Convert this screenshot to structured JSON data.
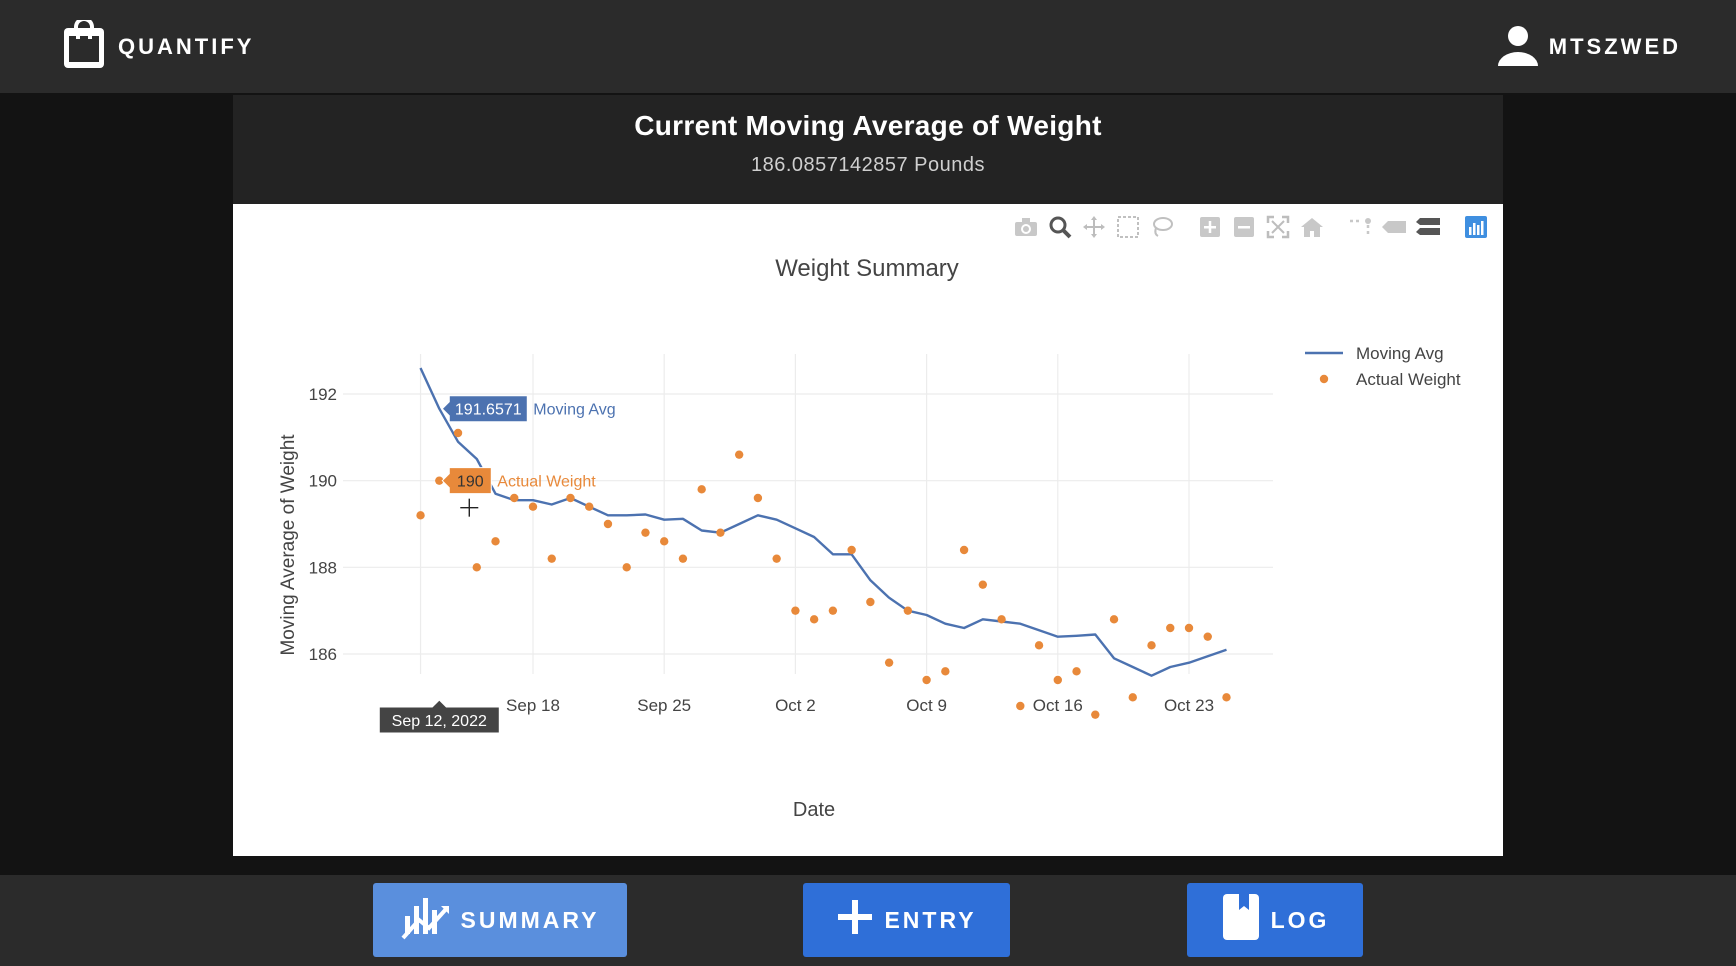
{
  "app": {
    "name": "QUANTIFY",
    "user": "MTSZWED"
  },
  "header": {
    "title": "Current Moving Average of Weight",
    "value_text": "186.0857142857 Pounds"
  },
  "modebar": {
    "icons": [
      "camera-icon",
      "zoom-icon",
      "pan-icon",
      "box-select-icon",
      "lasso-icon",
      "zoom-in-icon",
      "zoom-out-icon",
      "autoscale-icon",
      "reset-axes-icon",
      "spike-lines-icon",
      "hover-closest-icon",
      "hover-compare-icon",
      "plotly-logo-icon"
    ]
  },
  "nav": {
    "summary": "SUMMARY",
    "entry": "ENTRY",
    "log": "LOG"
  },
  "hover": {
    "moving_avg_value": "191.6571",
    "moving_avg_name": "Moving Avg",
    "actual_value": "190",
    "actual_name": "Actual Weight",
    "date": "Sep 12, 2022"
  },
  "colors": {
    "moving_avg": "#4c72b0",
    "actual": "#e8893a",
    "accent": "#2f6fd8"
  },
  "chart_data": {
    "type": "line",
    "title": "Weight Summary",
    "xlabel": "Date",
    "ylabel": "Moving Average of Weight",
    "x_ticks": [
      "Sep 18",
      "Sep 25",
      "Oct 2",
      "Oct 9",
      "Oct 16",
      "Oct 23"
    ],
    "x_tick_dates": [
      "2022-09-18",
      "2022-09-25",
      "2022-10-02",
      "2022-10-09",
      "2022-10-16",
      "2022-10-23"
    ],
    "y_ticks": [
      186,
      188,
      190,
      192
    ],
    "ylim": [
      184.0,
      193.0
    ],
    "xlim": [
      "2022-09-10",
      "2022-10-30"
    ],
    "legend_position": "top-right",
    "grid": true,
    "series": [
      {
        "name": "Moving Avg",
        "type": "line",
        "dates": [
          "2022-09-12",
          "2022-09-13",
          "2022-09-14",
          "2022-09-15",
          "2022-09-16",
          "2022-09-17",
          "2022-09-18",
          "2022-09-19",
          "2022-09-20",
          "2022-09-21",
          "2022-09-22",
          "2022-09-23",
          "2022-09-24",
          "2022-09-25",
          "2022-09-26",
          "2022-09-27",
          "2022-09-28",
          "2022-09-29",
          "2022-09-30",
          "2022-10-01",
          "2022-10-02",
          "2022-10-03",
          "2022-10-04",
          "2022-10-05",
          "2022-10-06",
          "2022-10-07",
          "2022-10-08",
          "2022-10-09",
          "2022-10-10",
          "2022-10-11",
          "2022-10-12",
          "2022-10-13",
          "2022-10-14",
          "2022-10-15",
          "2022-10-16",
          "2022-10-17",
          "2022-10-18",
          "2022-10-19",
          "2022-10-20",
          "2022-10-21",
          "2022-10-22",
          "2022-10-23",
          "2022-10-24",
          "2022-10-25"
        ],
        "values": [
          192.6,
          191.66,
          190.9,
          190.5,
          189.7,
          189.55,
          189.55,
          189.45,
          189.6,
          189.4,
          189.2,
          189.2,
          189.22,
          189.1,
          189.12,
          188.85,
          188.8,
          189.0,
          189.2,
          189.1,
          188.9,
          188.7,
          188.3,
          188.3,
          187.7,
          187.3,
          187.0,
          186.9,
          186.7,
          186.6,
          186.8,
          186.75,
          186.7,
          186.55,
          186.4,
          186.42,
          186.45,
          185.9,
          185.7,
          185.5,
          185.7,
          185.8,
          185.95,
          186.1
        ]
      },
      {
        "name": "Actual Weight",
        "type": "scatter",
        "dates": [
          "2022-09-12",
          "2022-09-13",
          "2022-09-14",
          "2022-09-15",
          "2022-09-16",
          "2022-09-17",
          "2022-09-18",
          "2022-09-19",
          "2022-09-20",
          "2022-09-21",
          "2022-09-22",
          "2022-09-23",
          "2022-09-24",
          "2022-09-25",
          "2022-09-26",
          "2022-09-27",
          "2022-09-28",
          "2022-09-29",
          "2022-09-30",
          "2022-10-01",
          "2022-10-02",
          "2022-10-03",
          "2022-10-04",
          "2022-10-05",
          "2022-10-06",
          "2022-10-07",
          "2022-10-08",
          "2022-10-09",
          "2022-10-10",
          "2022-10-11",
          "2022-10-12",
          "2022-10-13",
          "2022-10-14",
          "2022-10-15",
          "2022-10-16",
          "2022-10-17",
          "2022-10-18",
          "2022-10-19",
          "2022-10-20",
          "2022-10-21",
          "2022-10-22",
          "2022-10-23",
          "2022-10-24",
          "2022-10-25"
        ],
        "values": [
          189.2,
          190.0,
          191.1,
          188.0,
          188.6,
          189.6,
          189.4,
          188.2,
          189.6,
          189.4,
          189.0,
          188.0,
          188.8,
          188.6,
          188.2,
          189.8,
          188.8,
          190.6,
          189.6,
          188.2,
          187.0,
          186.8,
          187.0,
          188.4,
          187.2,
          185.8,
          187.0,
          185.4,
          185.6,
          188.4,
          187.6,
          186.8,
          184.8,
          186.2,
          185.4,
          185.6,
          184.6,
          186.8,
          185.0,
          186.2,
          186.6,
          186.6,
          186.4,
          185.0
        ]
      }
    ]
  }
}
